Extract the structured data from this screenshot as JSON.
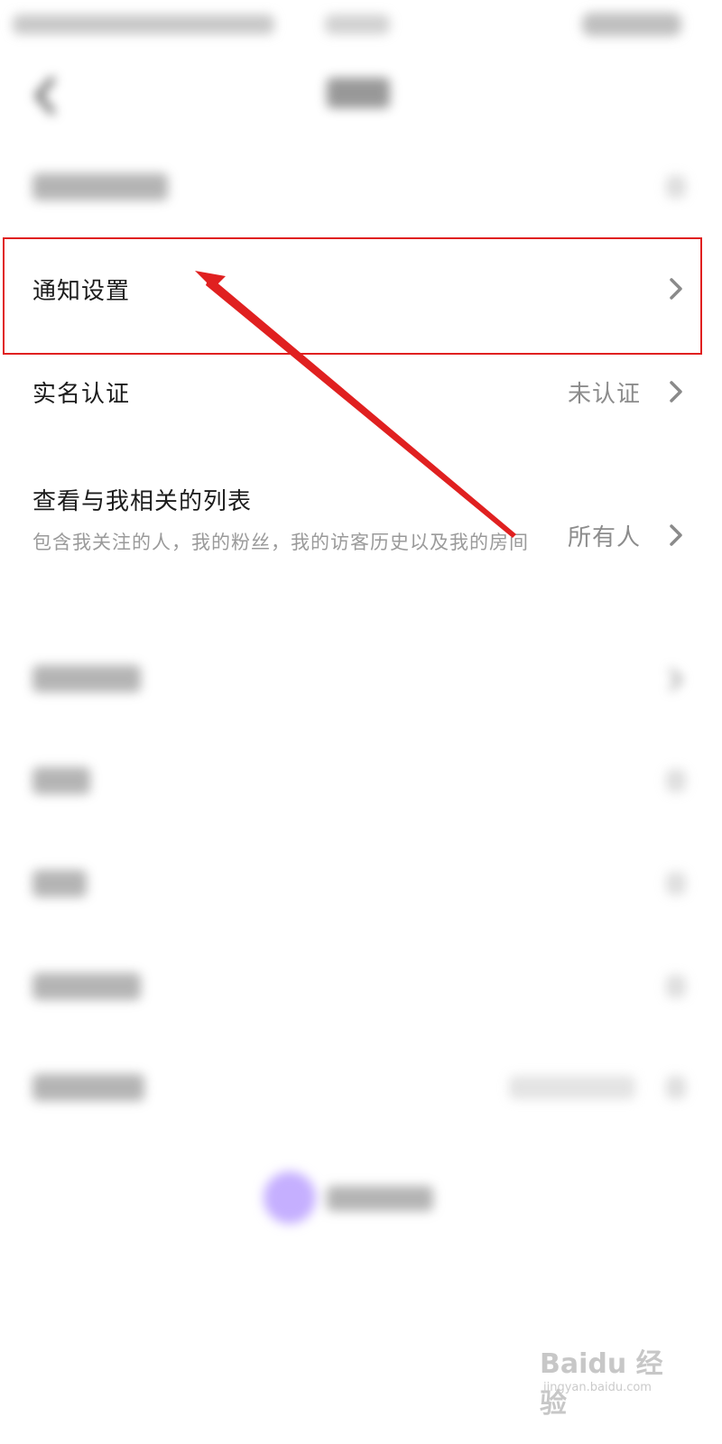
{
  "settings": {
    "rows": [
      {
        "label": "通知设置"
      },
      {
        "label": "实名认证",
        "value": "未认证"
      },
      {
        "label": "查看与我相关的列表",
        "sub": "包含我关注的人，我的粉丝，我的访客历史以及我的房间",
        "value": "所有人"
      }
    ]
  },
  "icons": {
    "back": "back-chevron-icon",
    "row_arrow": "chevron-right-icon"
  },
  "watermark": {
    "brand": "Baidu 经验",
    "url": "jingyan.baidu.com"
  },
  "colors": {
    "highlight": "#e02020",
    "accent": "#b69bff"
  }
}
